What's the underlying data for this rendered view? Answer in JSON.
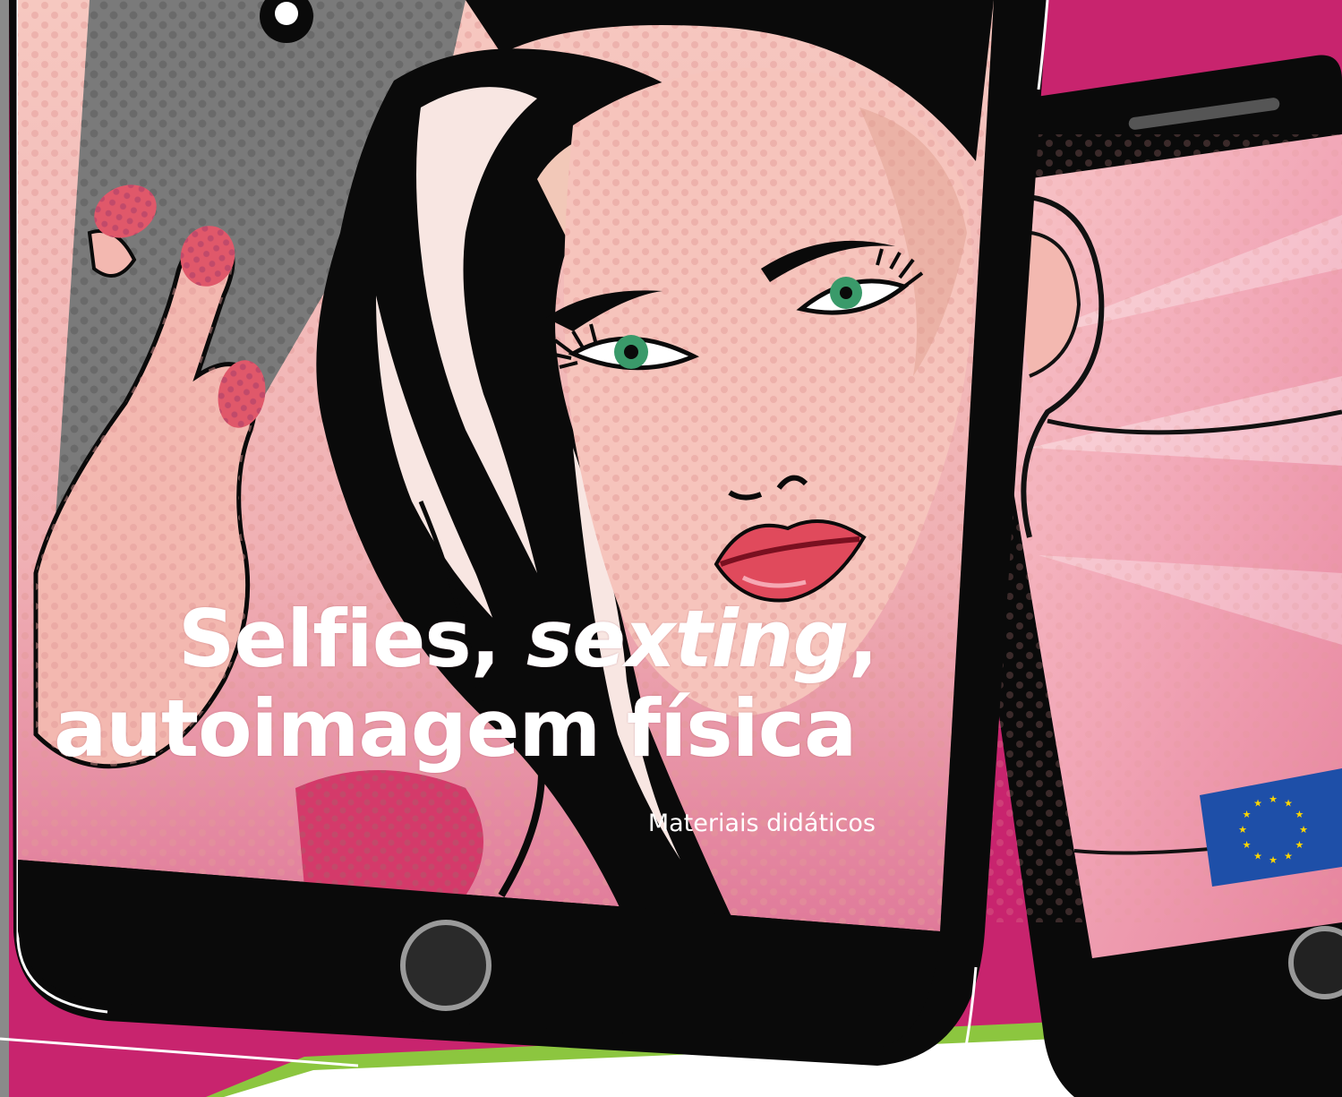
{
  "cover": {
    "title_part1": "Selfies,",
    "title_part2_italic": "sexting",
    "title_part3": ",",
    "title_line2": "autoimagem física",
    "subtitle": "Materiais didáticos"
  },
  "colors": {
    "background_magenta": "#c8246e",
    "device_black": "#0a0a0a",
    "skin_pink": "#f0b8b4",
    "lip_red": "#e04a5c",
    "eye_green": "#3a9a6a",
    "accent_green": "#8cc63f",
    "eu_blue": "#1e4fa8",
    "eu_yellow": "#ffd700"
  },
  "icons": {
    "home_button_large": "home-button-icon",
    "home_button_small": "home-button-icon",
    "eu_emblem": "eu-flag-icon"
  }
}
